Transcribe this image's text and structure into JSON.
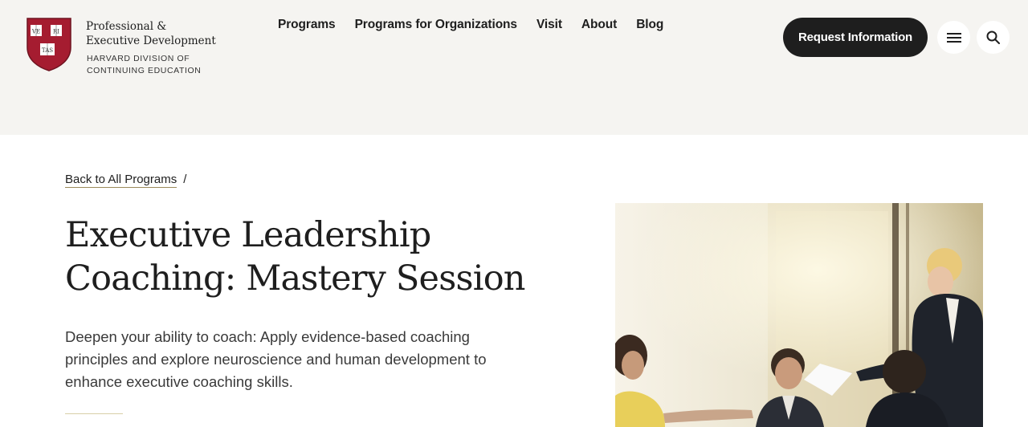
{
  "brand": {
    "title": "Professional &\nExecutive Development",
    "subtitle": "HARVARD DIVISION OF CONTINUING EDUCATION",
    "shield_text": [
      "VE",
      "RI",
      "TAS"
    ]
  },
  "nav": {
    "items": [
      {
        "label": "Programs"
      },
      {
        "label": "Programs for Organizations"
      },
      {
        "label": "Visit"
      },
      {
        "label": "About"
      },
      {
        "label": "Blog"
      }
    ]
  },
  "header_actions": {
    "request_label": "Request Information",
    "menu_icon": "hamburger-menu-icon",
    "search_icon": "search-icon"
  },
  "breadcrumb": {
    "back_label": "Back to All Programs",
    "separator": "/"
  },
  "program": {
    "title": "Executive Leadership Coaching: Mastery Session",
    "description": "Deepen your ability to coach: Apply evidence-based coaching principles and explore neuroscience and human development to enhance executive coaching skills."
  },
  "colors": {
    "header_bg": "#f5f4f1",
    "brand_crimson": "#a51c30",
    "button_dark": "#1e1e1e",
    "accent_gold": "#d8cfa8"
  }
}
